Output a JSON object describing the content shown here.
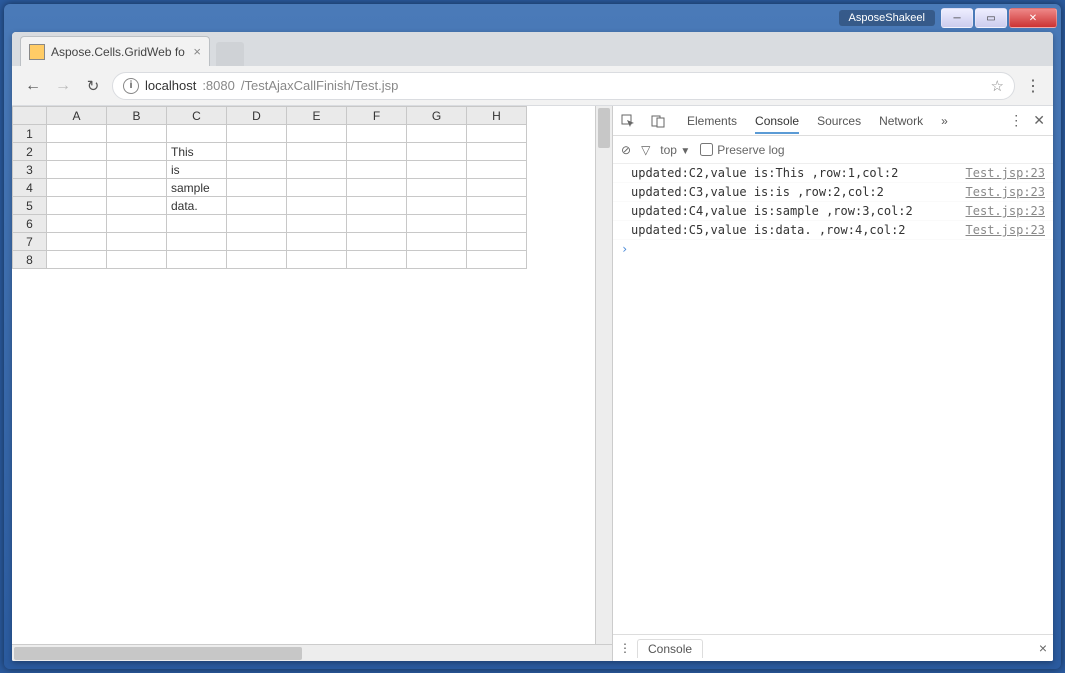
{
  "window": {
    "app_tag": "AsposeShakeel"
  },
  "browser": {
    "tab_title": "Aspose.Cells.GridWeb fo",
    "url_host": "localhost",
    "url_port": ":8080",
    "url_path": "/TestAjaxCallFinish/Test.jsp"
  },
  "spreadsheet": {
    "columns": [
      "A",
      "B",
      "C",
      "D",
      "E",
      "F",
      "G",
      "H"
    ],
    "rows": [
      {
        "n": "1",
        "c": [
          "",
          "",
          "",
          "",
          "",
          "",
          "",
          ""
        ]
      },
      {
        "n": "2",
        "c": [
          "",
          "",
          "This",
          "",
          "",
          "",
          "",
          ""
        ]
      },
      {
        "n": "3",
        "c": [
          "",
          "",
          "is",
          "",
          "",
          "",
          "",
          ""
        ]
      },
      {
        "n": "4",
        "c": [
          "",
          "",
          "sample",
          "",
          "",
          "",
          "",
          ""
        ]
      },
      {
        "n": "5",
        "c": [
          "",
          "",
          "data.",
          "",
          "",
          "",
          "",
          ""
        ]
      },
      {
        "n": "6",
        "c": [
          "",
          "",
          "",
          "",
          "",
          "",
          "",
          ""
        ]
      },
      {
        "n": "7",
        "c": [
          "",
          "",
          "",
          "",
          "",
          "",
          "",
          ""
        ]
      },
      {
        "n": "8",
        "c": [
          "",
          "",
          "",
          "",
          "",
          "",
          "",
          ""
        ]
      }
    ]
  },
  "devtools": {
    "tabs": {
      "elements": "Elements",
      "console": "Console",
      "sources": "Sources",
      "network": "Network"
    },
    "filter": {
      "scope": "top",
      "preserve_label": "Preserve log"
    },
    "logs": [
      {
        "msg": "updated:C2,value is:This ,row:1,col:2",
        "src": "Test.jsp:23"
      },
      {
        "msg": "updated:C3,value is:is ,row:2,col:2",
        "src": "Test.jsp:23"
      },
      {
        "msg": "updated:C4,value is:sample ,row:3,col:2",
        "src": "Test.jsp:23"
      },
      {
        "msg": "updated:C5,value is:data. ,row:4,col:2",
        "src": "Test.jsp:23"
      }
    ],
    "drawer_label": "Console"
  }
}
